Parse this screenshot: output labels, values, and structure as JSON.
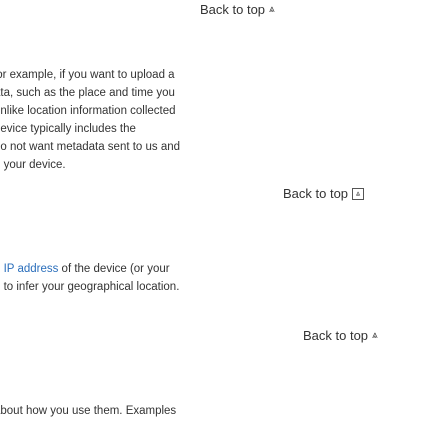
{
  "back_to_top_links": [
    {
      "label": "Back to top",
      "icon": "double-chevron-up-icon"
    },
    {
      "label": "Back to top",
      "icon": "boxed-chevron-up-icon"
    },
    {
      "label": "Back to top",
      "icon": "double-chevron-up-icon"
    }
  ],
  "section_1": {
    "lines": [
      "'or example, if you want to upload a",
      "ata, such as the place and time you",
      "unlike location information collected",
      " device typically includes the",
      "do not want metadata sent to us and",
      "n your device."
    ]
  },
  "section_2": {
    "line1_prefix": "e ",
    "line1_link": "IP address",
    "line1_suffix": " of the device (or your",
    "line2": "d to infer your geographical location."
  },
  "section_3": {
    "fragment": ";",
    "line": "about how you use them. Examples"
  }
}
